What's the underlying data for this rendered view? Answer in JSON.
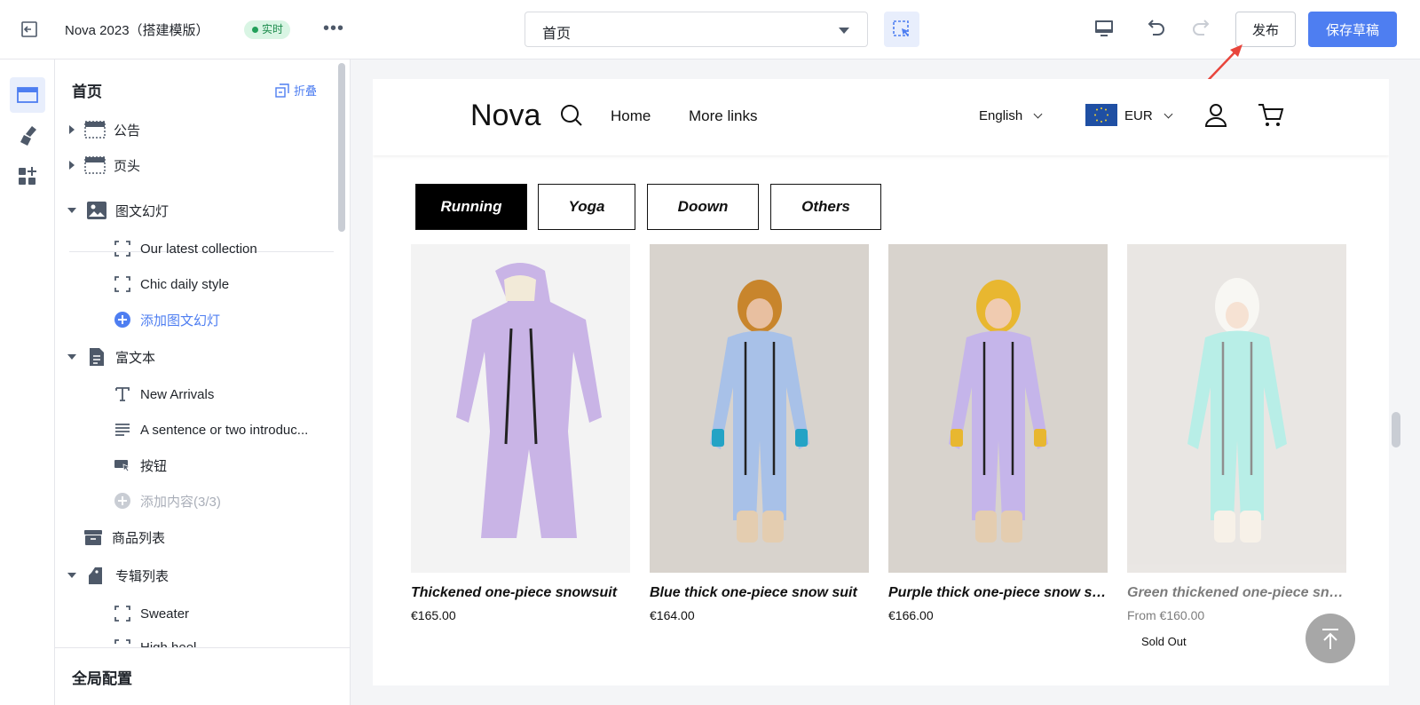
{
  "topbar": {
    "app_title": "Nova 2023（搭建模版）",
    "live_badge": "实时",
    "page_select_value": "首页",
    "publish_label": "发布",
    "save_label": "保存草稿"
  },
  "sidebar": {
    "title": "首页",
    "fold_label": "折叠",
    "tree": [
      {
        "label": "公告",
        "icon": "section-icon"
      },
      {
        "label": "页头",
        "icon": "section-icon"
      },
      {
        "label": "图文幻灯",
        "icon": "image-icon"
      },
      {
        "label": "Our latest collection",
        "icon": "frame-icon"
      },
      {
        "label": "Chic daily style",
        "icon": "frame-icon"
      },
      {
        "label": "添加图文幻灯",
        "icon": "plus-circle-icon"
      },
      {
        "label": "富文本",
        "icon": "document-icon"
      },
      {
        "label": "New Arrivals",
        "icon": "text-icon"
      },
      {
        "label": "A sentence or two introduc...",
        "icon": "paragraph-icon"
      },
      {
        "label": "按钮",
        "icon": "button-icon"
      },
      {
        "label": "添加内容(3/3)",
        "icon": "plus-circle-icon"
      },
      {
        "label": "商品列表",
        "icon": "archive-icon"
      },
      {
        "label": "专辑列表",
        "icon": "bag-icon"
      },
      {
        "label": "Sweater",
        "icon": "frame-icon"
      },
      {
        "label": "High heel",
        "icon": "frame-icon"
      }
    ],
    "footer_label": "全局配置"
  },
  "store": {
    "logo": "Nova",
    "nav": [
      "Home",
      "More links"
    ],
    "language": "English",
    "currency": "EUR",
    "tabs": [
      "Running",
      "Yoga",
      "Doown",
      "Others"
    ],
    "active_tab": "Running",
    "products": [
      {
        "name": "Thickened one-piece snowsuit",
        "price": "€165.00",
        "color": "#c9b4e6",
        "bg": "#f3f3f3"
      },
      {
        "name": "Blue thick one-piece snow suit",
        "price": "€164.00",
        "color": "#a8c1e8",
        "bg": "#d8d3cd"
      },
      {
        "name": "Purple thick one-piece snow suit",
        "price": "€166.00",
        "color": "#c5b5ea",
        "bg": "#d8d3cd"
      },
      {
        "name": "Green thickened one-piece sno...",
        "price": "From €160.00",
        "color": "#7fe1d4",
        "bg": "#d8d3cd"
      }
    ],
    "sold_out_label": "Sold Out"
  },
  "colors": {
    "accent": "#4e7ef1",
    "live_green": "#22a05a",
    "tab_active_bg": "#000000"
  }
}
